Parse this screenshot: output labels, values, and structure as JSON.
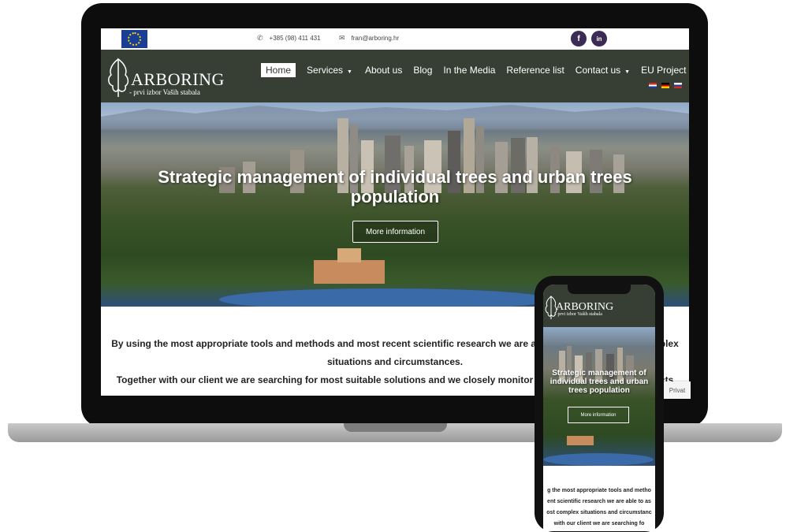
{
  "topbar": {
    "phone": "+385 (98) 411 431",
    "email": "fran@arboring.hr",
    "social": [
      {
        "name": "facebook",
        "label": "f"
      },
      {
        "name": "linkedin",
        "label": "in"
      }
    ]
  },
  "brand": {
    "name": "ARBORING",
    "tagline": "- prvi izbor Vaših stabala"
  },
  "nav": {
    "items": [
      {
        "label": "Home",
        "active": true
      },
      {
        "label": "Services",
        "dropdown": true
      },
      {
        "label": "About us"
      },
      {
        "label": "Blog"
      },
      {
        "label": "In the Media"
      },
      {
        "label": "Reference list"
      },
      {
        "label": "Contact us",
        "dropdown": true
      },
      {
        "label": "EU Project"
      }
    ]
  },
  "hero": {
    "title": "Strategic management of individual trees and urban trees population",
    "button": "More information"
  },
  "intro": {
    "line1": "By using the most appropriate tools and methods and most recent scientific research we are able to assess the most complex",
    "line2": "situations and circumstances.",
    "line3": "Together with our client we are searching for most suitable solutions and we closely monitor the implementation of projects"
  },
  "mobile": {
    "brand": "ARBORING",
    "tagline": "- prvi izbor Vaših stabala",
    "hero_title": "Strategic management of individual trees and urban trees population",
    "hero_button": "More information",
    "intro_lines": [
      "g the most appropriate tools and metho",
      "ent scientific research we are able to as",
      "ost complex situations and circumstanc",
      "with our client we are searching fo"
    ]
  },
  "privacy_badge": "Privat",
  "colors": {
    "navbar": "#373e34",
    "social": "#3c2b55",
    "eu_blue": "#1a3d96"
  }
}
